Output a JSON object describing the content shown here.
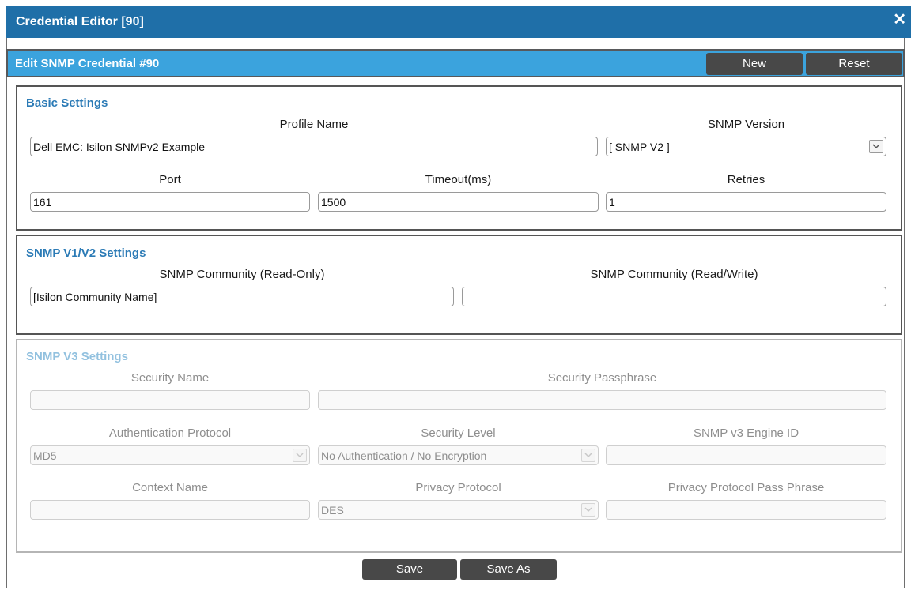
{
  "window": {
    "title": "Credential Editor [90]"
  },
  "panel": {
    "title": "Edit SNMP Credential #90",
    "new_label": "New",
    "reset_label": "Reset"
  },
  "basic": {
    "title": "Basic Settings",
    "profile_name_label": "Profile Name",
    "profile_name_value": "Dell EMC: Isilon SNMPv2 Example",
    "snmp_version_label": "SNMP Version",
    "snmp_version_value": "[ SNMP V2 ]",
    "port_label": "Port",
    "port_value": "161",
    "timeout_label": "Timeout(ms)",
    "timeout_value": "1500",
    "retries_label": "Retries",
    "retries_value": "1"
  },
  "v1v2": {
    "title": "SNMP V1/V2 Settings",
    "community_ro_label": "SNMP Community (Read-Only)",
    "community_ro_value": "[Isilon Community Name]",
    "community_rw_label": "SNMP Community (Read/Write)",
    "community_rw_value": ""
  },
  "v3": {
    "title": "SNMP V3 Settings",
    "security_name_label": "Security Name",
    "security_passphrase_label": "Security Passphrase",
    "auth_protocol_label": "Authentication Protocol",
    "auth_protocol_value": "MD5",
    "security_level_label": "Security Level",
    "security_level_value": "No Authentication / No Encryption",
    "engine_id_label": "SNMP v3 Engine ID",
    "context_name_label": "Context Name",
    "privacy_protocol_label": "Privacy Protocol",
    "privacy_protocol_value": "DES",
    "privacy_passphrase_label": "Privacy Protocol Pass Phrase"
  },
  "footer": {
    "save_label": "Save",
    "save_as_label": "Save As"
  },
  "colors": {
    "titlebar": "#1f6fa8",
    "panel_header": "#3ba3dd",
    "section_title": "#2c7bb6",
    "button": "#484848"
  }
}
